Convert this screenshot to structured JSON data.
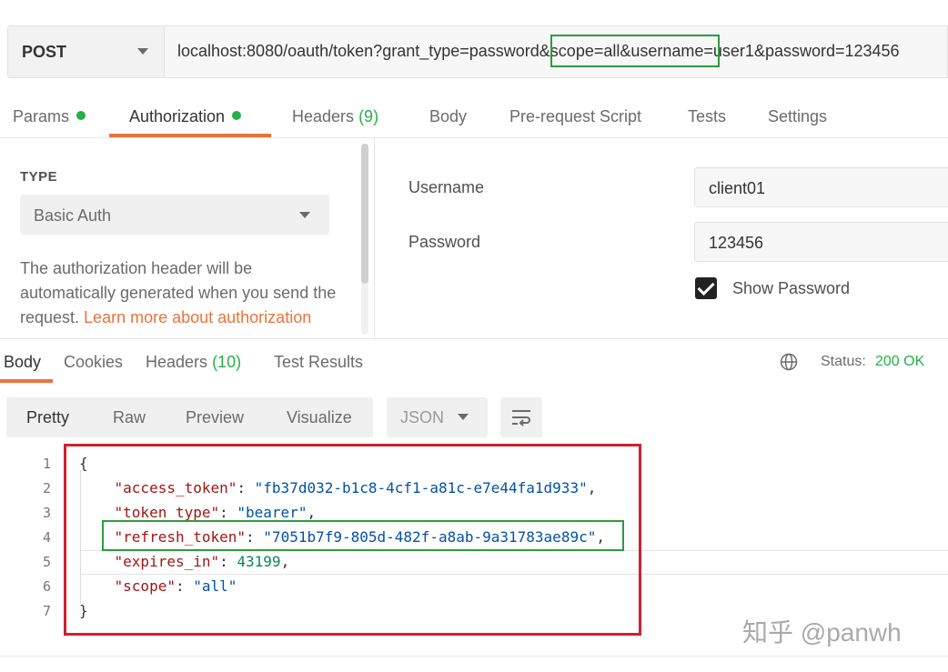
{
  "request": {
    "method": "POST",
    "url_prefix": "localhost:8080/oauth/token?",
    "url_highlight": "grant_type=password",
    "url_suffix": "&scope=all&username=user1&password=123456"
  },
  "request_tabs": [
    {
      "label": "Params",
      "dot": true
    },
    {
      "label": "Authorization",
      "dot": true,
      "active": true
    },
    {
      "label": "Headers",
      "count": "(9)"
    },
    {
      "label": "Body"
    },
    {
      "label": "Pre-request Script"
    },
    {
      "label": "Tests"
    },
    {
      "label": "Settings"
    }
  ],
  "auth": {
    "type_heading": "TYPE",
    "type_value": "Basic Auth",
    "description": "The authorization header will be automatically generated when you send the request. ",
    "learn_more": "Learn more about authorization",
    "username_label": "Username",
    "username_value": "client01",
    "password_label": "Password",
    "password_value": "123456",
    "show_password_label": "Show Password",
    "show_password_checked": true
  },
  "response_tabs": [
    {
      "label": "Body",
      "active": true
    },
    {
      "label": "Cookies"
    },
    {
      "label": "Headers",
      "count": "(10)"
    },
    {
      "label": "Test Results"
    }
  ],
  "status": {
    "label": "Status:",
    "value": "200 OK"
  },
  "toolbar": {
    "views": [
      "Pretty",
      "Raw",
      "Preview",
      "Visualize"
    ],
    "format": "JSON"
  },
  "response_body": {
    "line_numbers": [
      "1",
      "2",
      "3",
      "4",
      "5",
      "6",
      "7"
    ],
    "open_brace": "{",
    "close_brace": "}",
    "fields": [
      {
        "key": "\"access_token\"",
        "value": "\"fb37d032-b1c8-4cf1-a81c-e7e44fa1d933\"",
        "type": "string",
        "comma": ","
      },
      {
        "key": "\"token_type\"",
        "value": "\"bearer\"",
        "type": "string",
        "comma": ","
      },
      {
        "key": "\"refresh_token\"",
        "value": "\"7051b7f9-805d-482f-a8ab-9a31783ae89c\"",
        "type": "string",
        "comma": ","
      },
      {
        "key": "\"expires_in\"",
        "value": "43199",
        "type": "number",
        "comma": ","
      },
      {
        "key": "\"scope\"",
        "value": "\"all\"",
        "type": "string",
        "comma": ""
      }
    ]
  },
  "watermark": "知乎 @panwh",
  "colors": {
    "accent": "#e8743b",
    "success": "#26b047",
    "red_box": "#d0202e",
    "green_box": "#2d9b3f"
  }
}
